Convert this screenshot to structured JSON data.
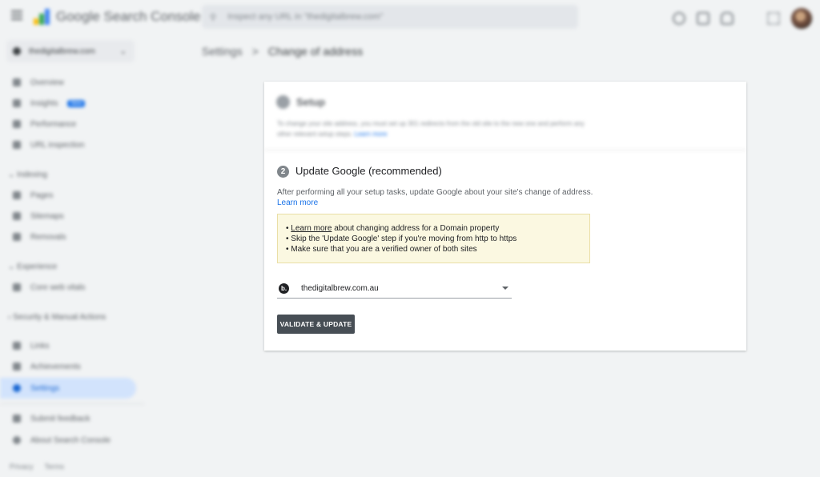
{
  "app": {
    "title": "Google Search Console",
    "search_placeholder": "Inspect any URL in \"thedigitalbrew.com\""
  },
  "breadcrumb": {
    "parent": "Settings",
    "separator": ">",
    "current": "Change of address"
  },
  "sidebar": {
    "property": "thedigitalbrew.com",
    "items": [
      {
        "label": "Overview"
      },
      {
        "label": "Insights",
        "badge": "New"
      },
      {
        "label": "Performance"
      },
      {
        "label": "URL inspection"
      }
    ],
    "groups": {
      "indexing": "Indexing",
      "experience": "Experience",
      "security": "Security & Manual Actions"
    },
    "indexing_items": [
      {
        "label": "Pages"
      },
      {
        "label": "Sitemaps"
      },
      {
        "label": "Removals"
      }
    ],
    "experience_items": [
      {
        "label": "Core web vitals"
      }
    ],
    "lower_items": [
      {
        "label": "Links"
      },
      {
        "label": "Achievements"
      },
      {
        "label": "Settings"
      }
    ],
    "bottom_items": [
      {
        "label": "Submit feedback"
      },
      {
        "label": "About Search Console"
      }
    ],
    "footer": {
      "privacy": "Privacy",
      "terms": "Terms"
    }
  },
  "step1": {
    "title": "Setup",
    "description": "To change your site address, you must set up 301 redirects from the old site to the new one and perform any other relevant setup steps.",
    "learn_more": "Learn more"
  },
  "step2": {
    "number": "2",
    "title": "Update Google (recommended)",
    "description": "After performing all your setup tasks, update Google about your site's change of address.",
    "learn_more": "Learn more",
    "notes": {
      "line1_link": "Learn more",
      "line1_rest": " about changing address for a Domain property",
      "line2": "Skip the 'Update Google' step if you're moving from http to https",
      "line3": "Make sure that you are a verified owner of both sites"
    },
    "site_select": {
      "icon_letter": "b.",
      "value": "thedigitalbrew.com.au"
    },
    "validate_button": "VALIDATE & UPDATE"
  }
}
